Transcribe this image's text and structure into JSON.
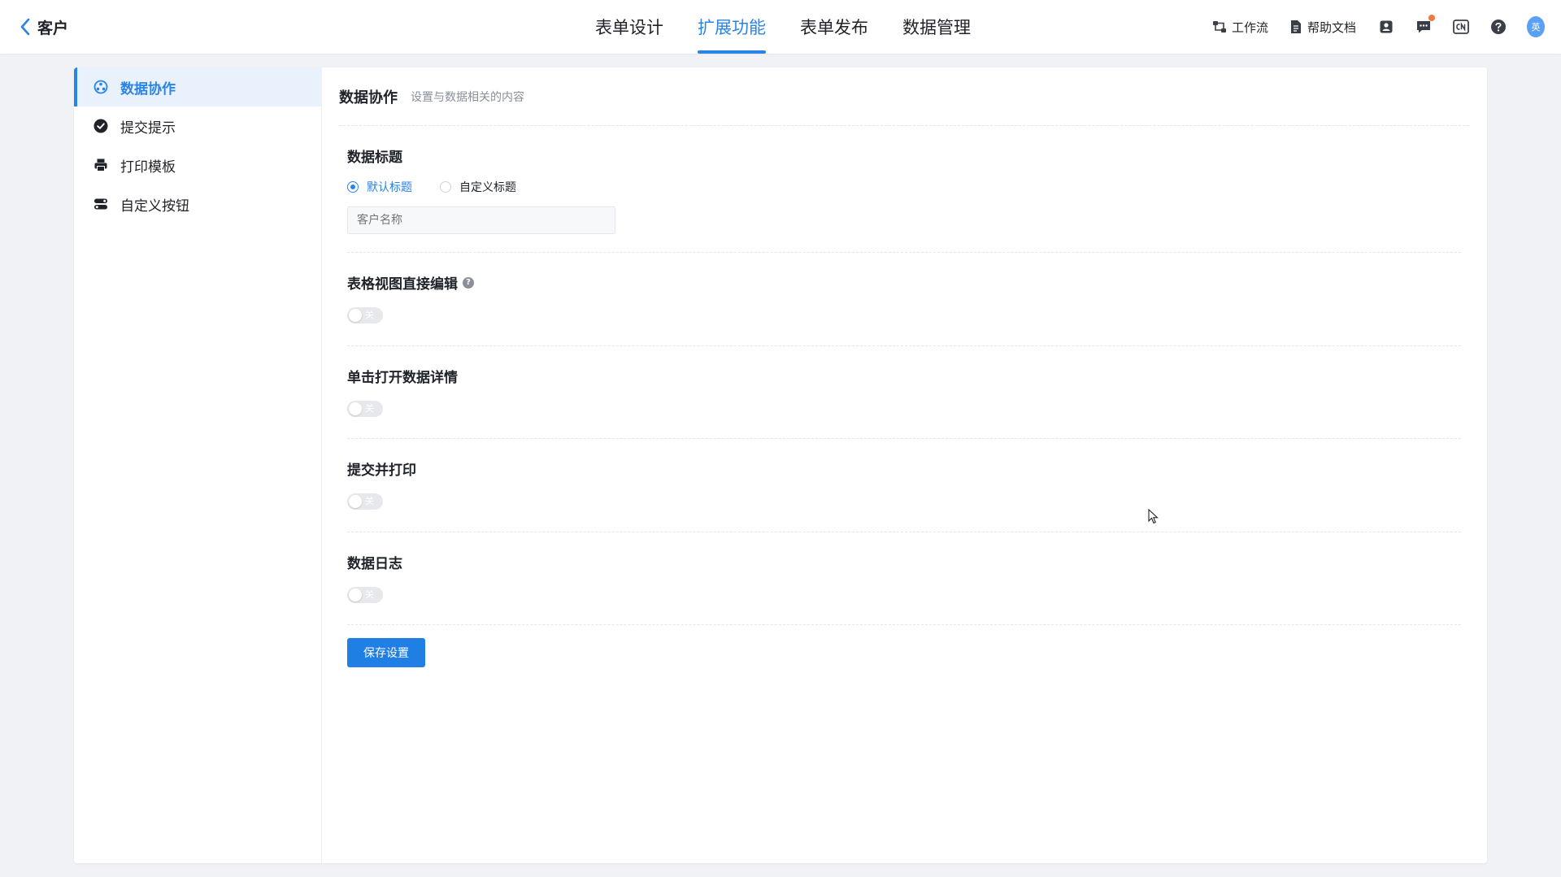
{
  "header": {
    "back_label": "客户",
    "tabs": [
      {
        "label": "表单设计",
        "active": false
      },
      {
        "label": "扩展功能",
        "active": true
      },
      {
        "label": "表单发布",
        "active": false
      },
      {
        "label": "数据管理",
        "active": false
      }
    ],
    "tools": {
      "workflow_label": "工作流",
      "help_docs_label": "帮助文档",
      "avatar_text": "英"
    }
  },
  "sidebar": {
    "items": [
      {
        "label": "数据协作",
        "icon": "data-collab-icon",
        "active": true
      },
      {
        "label": "提交提示",
        "icon": "check-circle-icon",
        "active": false
      },
      {
        "label": "打印模板",
        "icon": "printer-icon",
        "active": false
      },
      {
        "label": "自定义按钮",
        "icon": "custom-button-icon",
        "active": false
      }
    ]
  },
  "main": {
    "title": "数据协作",
    "subtitle": "设置与数据相关的内容",
    "data_title": {
      "label": "数据标题",
      "options": [
        {
          "label": "默认标题",
          "checked": true
        },
        {
          "label": "自定义标题",
          "checked": false
        }
      ],
      "input_placeholder": "客户名称"
    },
    "toggles": [
      {
        "label": "表格视图直接编辑",
        "has_help": true,
        "state_text": "关",
        "on": false
      },
      {
        "label": "单击打开数据详情",
        "has_help": false,
        "state_text": "关",
        "on": false
      },
      {
        "label": "提交并打印",
        "has_help": false,
        "state_text": "关",
        "on": false
      },
      {
        "label": "数据日志",
        "has_help": false,
        "state_text": "关",
        "on": false
      }
    ],
    "save_label": "保存设置"
  },
  "colors": {
    "accent": "#2a84e8",
    "button": "#1f7fe5",
    "background": "#f0f2f5",
    "notification_dot": "#f0783c"
  }
}
